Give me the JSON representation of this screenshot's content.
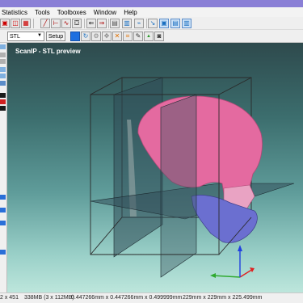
{
  "menu": [
    "Statistics",
    "Tools",
    "Toolboxes",
    "Window",
    "Help"
  ],
  "toolbar2": {
    "mode_select": "STL",
    "setup_label": "Setup",
    "stl_small_label": "STL"
  },
  "viewport": {
    "title": "ScanIP - STL preview"
  },
  "status": {
    "dims": "2 x 451",
    "memory": "338MB (3 x 112MB)",
    "spacing": "0.447266mm x 0.447266mm x 0.499999mm",
    "extent": "229mm x 229mm x 225.499mm"
  },
  "colors": {
    "skull": "#e46aa0",
    "mandible": "#6b6fd0",
    "bounding_box": "#2a2a2a",
    "axis_x": "#e02020",
    "axis_y": "#2faa2f",
    "axis_z": "#2040e0"
  }
}
